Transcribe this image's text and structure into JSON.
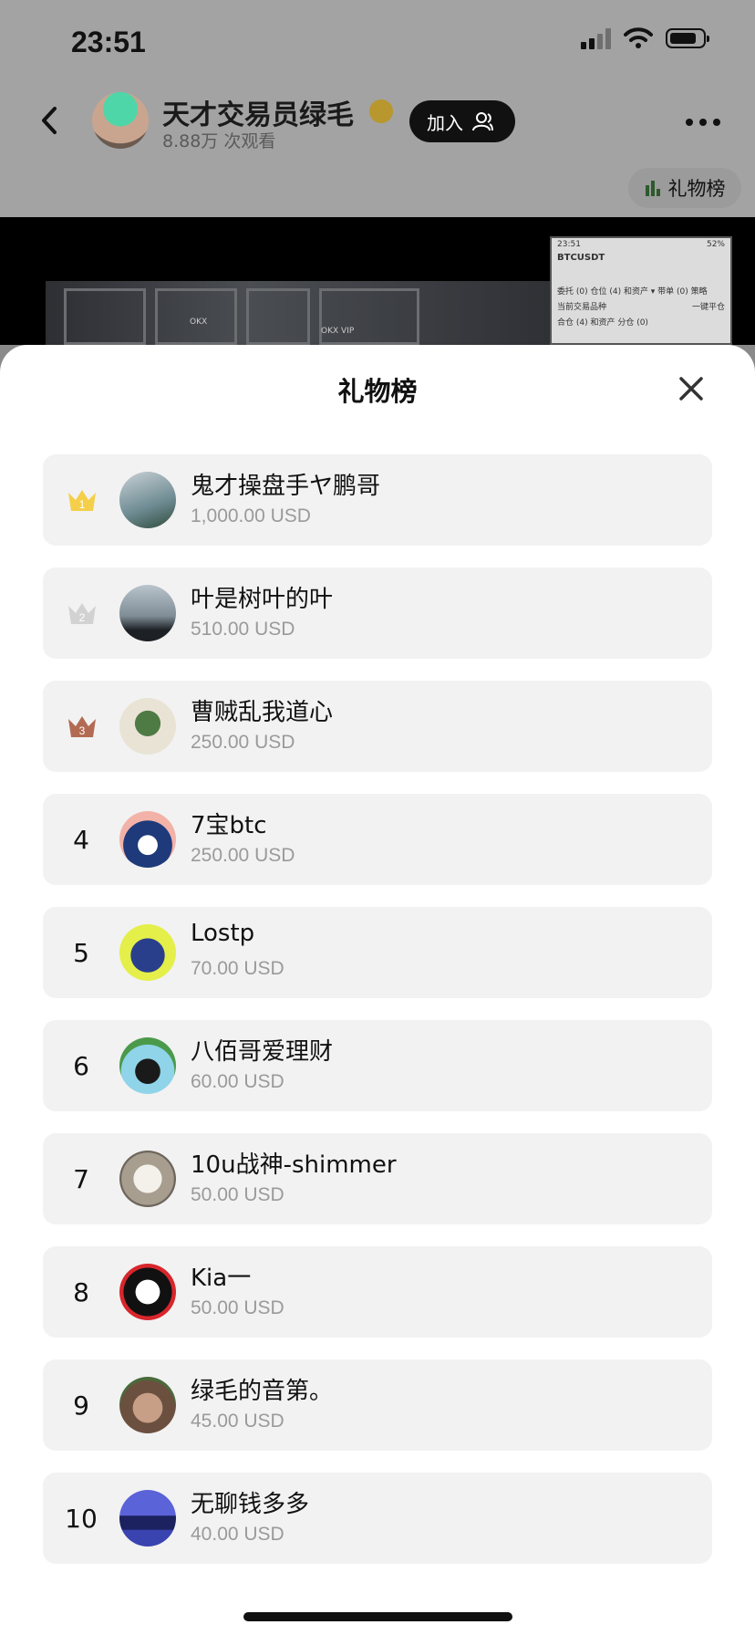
{
  "status_bar": {
    "time": "23:51"
  },
  "header": {
    "host_name": "天才交易员绿毛",
    "views": "8.88万 次观看",
    "join_label": "加入",
    "gift_rank_label": "礼物榜"
  },
  "pip": {
    "time": "23:51",
    "symbol": "BTCUSDT",
    "battery": "52%",
    "tabs": "委托 (0)   仓位 (4) 和资产 ▾   带单 (0)   策略",
    "option": "当前交易品种",
    "close_all": "一键平仓",
    "sub": "合仓 (4) 和资产    分仓 (0)"
  },
  "video": {
    "shelf_label_1": "OKX",
    "shelf_label_2": "OKX VIP"
  },
  "sheet": {
    "title": "礼物榜"
  },
  "leaderboard": [
    {
      "rank": "1",
      "name": "鬼才操盘手ヤ鹏哥",
      "amount": "1,000.00 USD",
      "crown": "gold"
    },
    {
      "rank": "2",
      "name": "叶是树叶的叶",
      "amount": "510.00 USD",
      "crown": "silver"
    },
    {
      "rank": "3",
      "name": "曹贼乱我道心",
      "amount": "250.00 USD",
      "crown": "bronze"
    },
    {
      "rank": "4",
      "name": "7宝btc",
      "amount": "250.00 USD"
    },
    {
      "rank": "5",
      "name": "Lostp",
      "amount": "70.00 USD"
    },
    {
      "rank": "6",
      "name": "八佰哥爱理财",
      "amount": "60.00 USD"
    },
    {
      "rank": "7",
      "name": "10u战神-shimmer",
      "amount": "50.00 USD"
    },
    {
      "rank": "8",
      "name": "Kia一",
      "amount": "50.00 USD"
    },
    {
      "rank": "9",
      "name": "绿毛的音第。",
      "amount": "45.00 USD"
    },
    {
      "rank": "10",
      "name": "无聊钱多多",
      "amount": "40.00 USD"
    }
  ],
  "colors": {
    "gold": "#f5cf4a",
    "silver": "#d2d2d2",
    "bronze": "#b36a53",
    "row_bg": "#f2f2f2",
    "amount": "#9a9a9a"
  }
}
